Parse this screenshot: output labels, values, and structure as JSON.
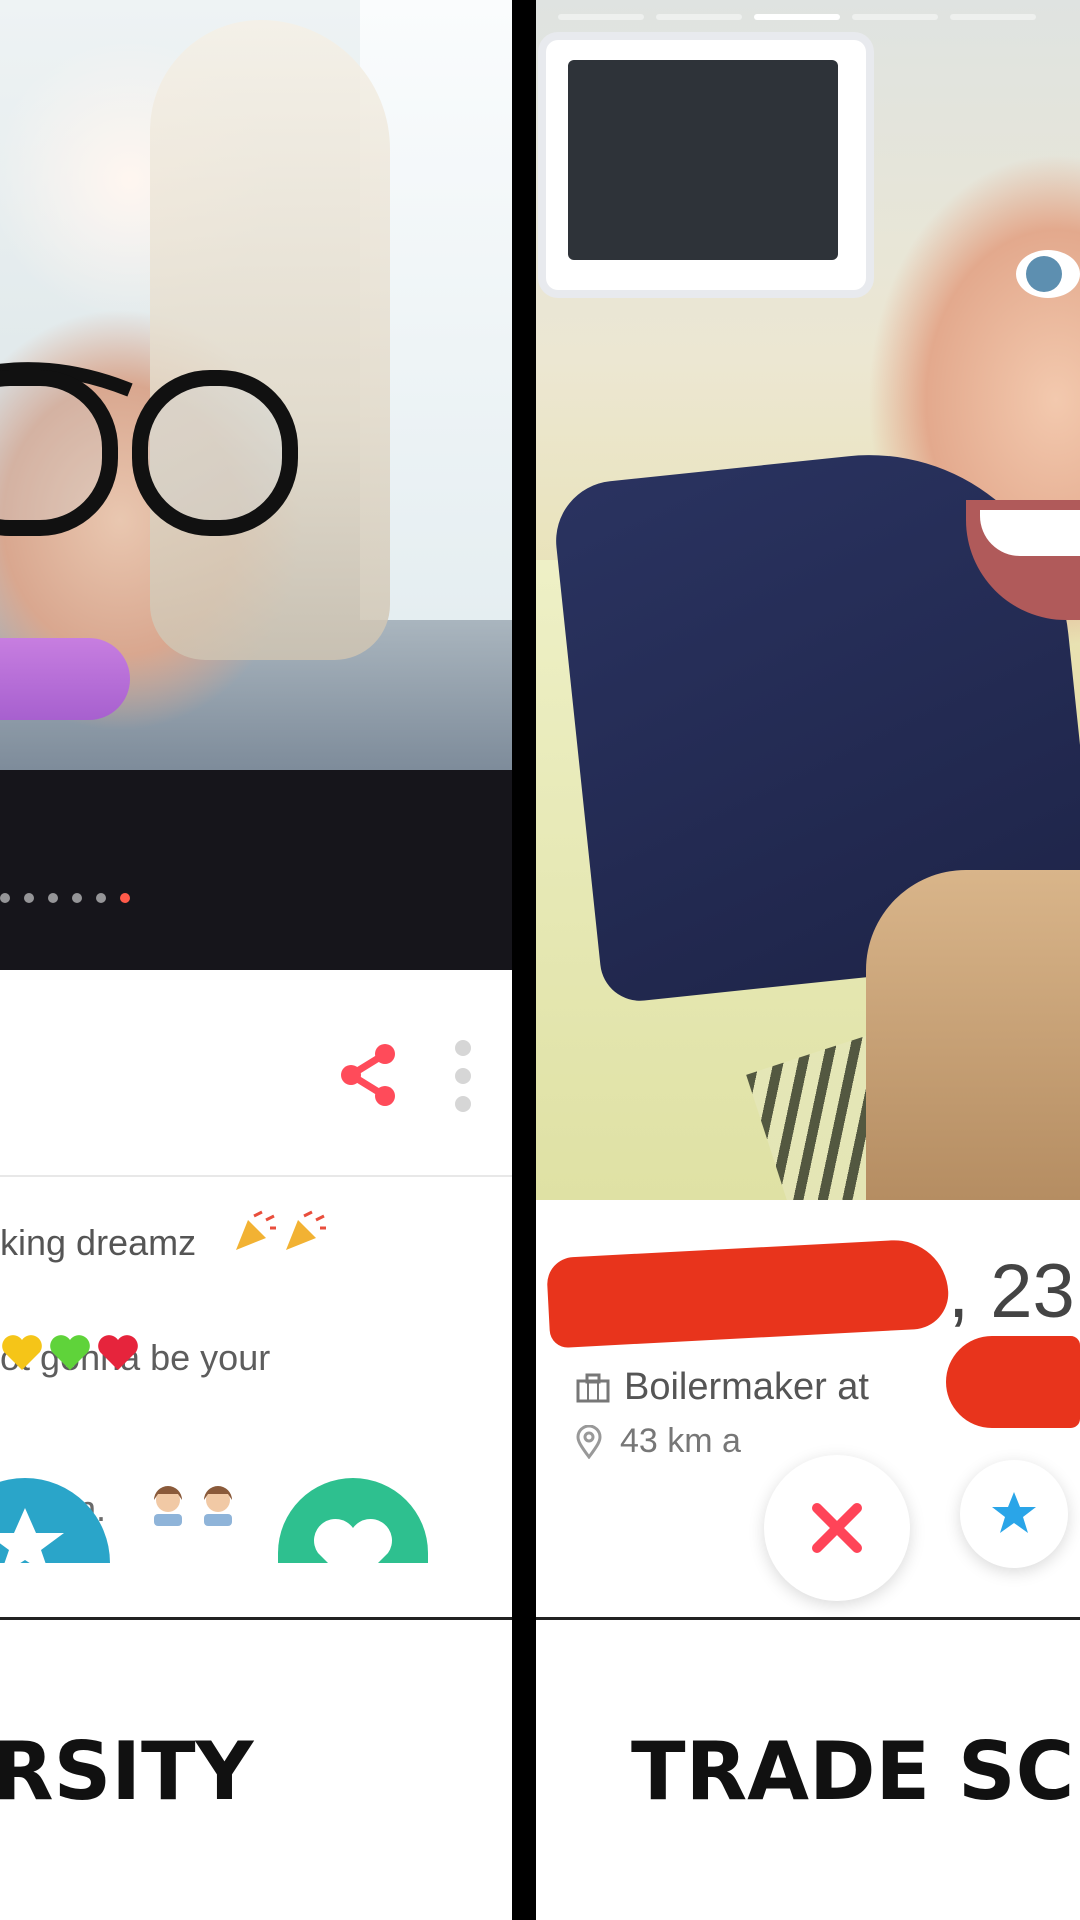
{
  "left_card": {
    "bio_line1": "king dreamz",
    "bio_line2": "ot gonna be your",
    "bio_line3": "n.",
    "caption": "RSITY"
  },
  "right_card": {
    "age": ", 23",
    "job": "Boilermaker at",
    "distance": "43 km a",
    "caption": "TRADE SC"
  },
  "colors": {
    "accent_red": "#ff5a4a",
    "share_icon": "#ff4b5a",
    "redaction": "#e8341c",
    "superlike_blue": "#2aa5e8",
    "like_green": "#2ec08f",
    "nope_red": "#ff4458"
  },
  "icons": {
    "share": "share-icon",
    "more": "more-vertical-icon",
    "briefcase": "briefcase-icon",
    "location": "location-pin-icon",
    "nope": "close-icon",
    "superlike": "star-icon"
  }
}
